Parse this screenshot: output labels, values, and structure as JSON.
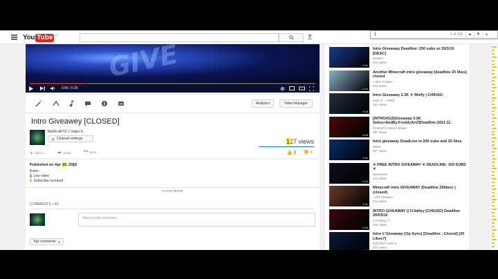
{
  "topbar": {
    "logo_you": "You",
    "logo_tube": "Tube",
    "logo_country": "BG"
  },
  "findbar": {
    "query": "1",
    "count": "1 of 135"
  },
  "player": {
    "art_word": "GIVE",
    "time": "0:05 / 0:26",
    "progress_fraction": 0.19
  },
  "editbar": {
    "analytics": "Analytics",
    "video_manager": "Video Manager"
  },
  "video": {
    "title_a": "Intro Giveawey [CLOSED]",
    "channel": "BEAR ARTZ // Veljko K.",
    "channel_settings": "Channel settings",
    "views_hl": "1",
    "views_rest": "27 views",
    "add_to": "Add to",
    "share": "Share",
    "more": "More",
    "likes": "1",
    "dislikes": "0",
    "like_ratio": 1.0
  },
  "description": {
    "published_pre": "Published on Apr ",
    "published_d1": "1",
    "published_d2": "8, 20",
    "published_d3": "1",
    "published_d4": "6",
    "rules": "Rules :",
    "rule1_num": "1",
    "rule1_text": ". Like video",
    "rule2": "2. Subscribe na kanal",
    "show_more": "SHOW MORE"
  },
  "comments": {
    "header": "COMMENTS • 60",
    "placeholder": "Add a public comment...",
    "sort": "Top comments"
  },
  "recommendations": [
    {
      "title": "Intro Giveaway Deadline: 250 subs or 20/3/16 [DESC]",
      "channel": "xSaeFx",
      "views": "241 views",
      "duration": "0:11",
      "bg": "#1a3a8a"
    },
    {
      "title": "Another Minecraft intro giveaway [deadline 20 likes] closed",
      "channel": "~UFX Srsiase~",
      "views": "243 views",
      "duration": "0:23",
      "bg": "#8ab0c8"
    },
    {
      "title": "Intro Giveaway 2.3K ✕ Wolfy | CHIUSO.",
      "channel": "Gian G. ~ Wolfy",
      "views": "251 views",
      "duration": "0:23",
      "bg": "#203040"
    },
    {
      "title": "[INTRO#1/2]Giveaway 0.5K Subscribe|By:FreddyArtZ|Deadline:2011.11.",
      "channel": "FreddyFX review design",
      "views": "497 views",
      "duration": "0:08",
      "bg": "#4a0a0a"
    },
    {
      "title": "Intro giveaway DeadLine in 200 subs and 20 likes",
      "channel": "MaZe",
      "views": "427 views",
      "duration": "0:11",
      "bg": "#0a2a6a"
    },
    {
      "title": "✕ FREE INTRO GIVEAWAY ✕ DEADLINE: 150 SUBS ✕",
      "channel": "iNameArts",
      "views": "171 views",
      "duration": "0:13",
      "bg": "#10101a"
    },
    {
      "title": "Minecraft intro GIVEAWAY (Deadline 20likes! ) (closed)",
      "channel": "~UFX Srsiase~",
      "views": "271 views",
      "duration": "0:21",
      "bg": "#6a3a2a"
    },
    {
      "title": "INTRO GIVEAWAY || Fr3ddyy [CHIUSO] Deadline 20/03/16",
      "channel": "1 Fr3ddyy T",
      "views": "424 views",
      "duration": "0:13",
      "bg": "#3a0a10"
    },
    {
      "title": "Intro // Giveaway [Op-Sync] [Deadline : Closed] [20 Likes?]",
      "channel": "EdCARZ / Nick S",
      "views": "574 views",
      "duration": "0:16",
      "bg": "#0a1a3a"
    }
  ],
  "colors": {
    "highlight": "#ffe600",
    "youtube_red": "#e62117",
    "progress_red": "#cc181e",
    "link_blue": "#167ac6"
  }
}
